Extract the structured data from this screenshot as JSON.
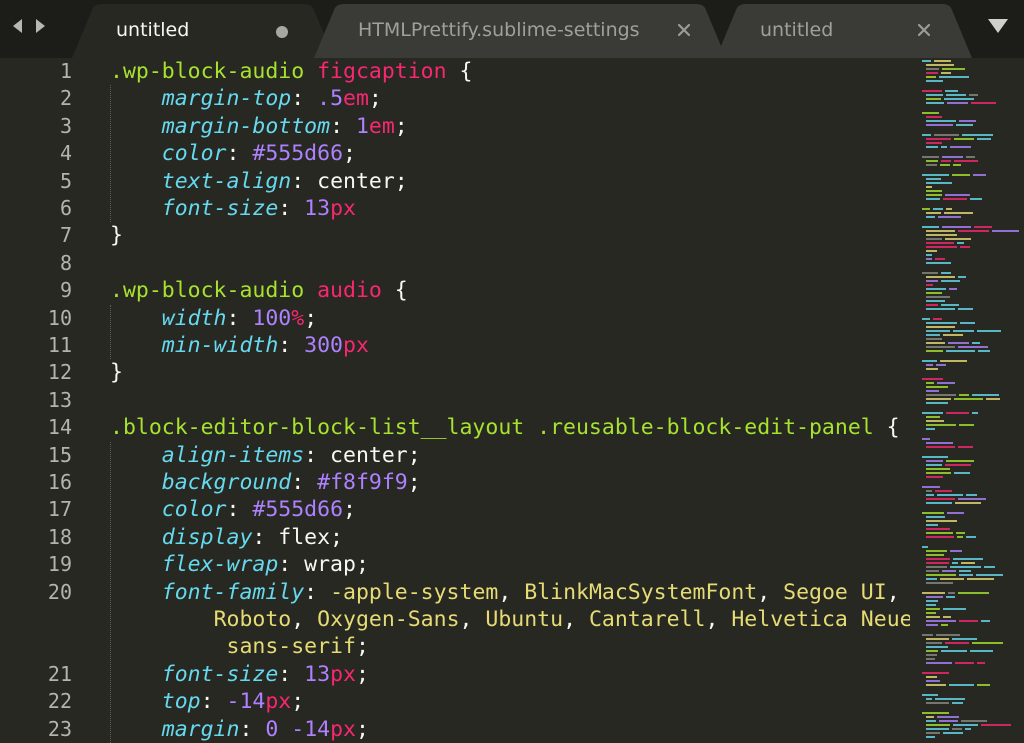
{
  "tabs": [
    {
      "title": "untitled",
      "active": true,
      "modified": true
    },
    {
      "title": "HTMLPrettify.sublime-settings",
      "active": false,
      "modified": false
    },
    {
      "title": "untitled",
      "active": false,
      "modified": false
    }
  ],
  "icons": {
    "back": "chevron-left-icon",
    "forward": "chevron-right-icon",
    "tab_menu": "triangle-down-icon",
    "close": "close-icon",
    "dirty": "modified-dot-icon"
  },
  "colors": {
    "background": "#272822",
    "tabbar": "#1c1d19",
    "selector": "#a6e22e",
    "tag": "#f92672",
    "property": "#66d9ef",
    "number": "#ae81ff",
    "string": "#e6db74",
    "text": "#f8f8f2",
    "line_number": "#b4b4ad"
  },
  "line_numbers": [
    "1",
    "2",
    "3",
    "4",
    "5",
    "6",
    "7",
    "8",
    "9",
    "10",
    "11",
    "12",
    "13",
    "14",
    "15",
    "16",
    "17",
    "18",
    "19",
    "20",
    "",
    "",
    "21",
    "22",
    "23"
  ],
  "code_lines": [
    [
      [
        "sel",
        ".wp-block-audio "
      ],
      [
        "tag",
        "figcaption"
      ],
      [
        "pun",
        " {"
      ]
    ],
    [
      [
        "pun",
        "    "
      ],
      [
        "prop",
        "margin-top"
      ],
      [
        "pun",
        ": "
      ],
      [
        "num",
        ".5"
      ],
      [
        "unit",
        "em"
      ],
      [
        "pun",
        ";"
      ]
    ],
    [
      [
        "pun",
        "    "
      ],
      [
        "prop",
        "margin-bottom"
      ],
      [
        "pun",
        ": "
      ],
      [
        "num",
        "1"
      ],
      [
        "unit",
        "em"
      ],
      [
        "pun",
        ";"
      ]
    ],
    [
      [
        "pun",
        "    "
      ],
      [
        "prop",
        "color"
      ],
      [
        "pun",
        ": "
      ],
      [
        "num",
        "#555d66"
      ],
      [
        "pun",
        ";"
      ]
    ],
    [
      [
        "pun",
        "    "
      ],
      [
        "prop",
        "text-align"
      ],
      [
        "pun",
        ": center;"
      ]
    ],
    [
      [
        "pun",
        "    "
      ],
      [
        "prop",
        "font-size"
      ],
      [
        "pun",
        ": "
      ],
      [
        "num",
        "13"
      ],
      [
        "unit",
        "px"
      ]
    ],
    [
      [
        "pun",
        "}"
      ]
    ],
    [],
    [
      [
        "sel",
        ".wp-block-audio "
      ],
      [
        "tag",
        "audio"
      ],
      [
        "pun",
        " {"
      ]
    ],
    [
      [
        "pun",
        "    "
      ],
      [
        "prop",
        "width"
      ],
      [
        "pun",
        ": "
      ],
      [
        "num",
        "100"
      ],
      [
        "unit",
        "%"
      ],
      [
        "pun",
        ";"
      ]
    ],
    [
      [
        "pun",
        "    "
      ],
      [
        "prop",
        "min-width"
      ],
      [
        "pun",
        ": "
      ],
      [
        "num",
        "300"
      ],
      [
        "unit",
        "px"
      ]
    ],
    [
      [
        "pun",
        "}"
      ]
    ],
    [],
    [
      [
        "sel",
        ".block-editor-block-list__layout .reusable-block-edit-panel"
      ],
      [
        "pun",
        " {"
      ]
    ],
    [
      [
        "pun",
        "    "
      ],
      [
        "prop",
        "align-items"
      ],
      [
        "pun",
        ": center;"
      ]
    ],
    [
      [
        "pun",
        "    "
      ],
      [
        "prop",
        "background"
      ],
      [
        "pun",
        ": "
      ],
      [
        "num",
        "#f8f9f9"
      ],
      [
        "pun",
        ";"
      ]
    ],
    [
      [
        "pun",
        "    "
      ],
      [
        "prop",
        "color"
      ],
      [
        "pun",
        ": "
      ],
      [
        "num",
        "#555d66"
      ],
      [
        "pun",
        ";"
      ]
    ],
    [
      [
        "pun",
        "    "
      ],
      [
        "prop",
        "display"
      ],
      [
        "pun",
        ": flex;"
      ]
    ],
    [
      [
        "pun",
        "    "
      ],
      [
        "prop",
        "flex-wrap"
      ],
      [
        "pun",
        ": wrap;"
      ]
    ],
    [
      [
        "pun",
        "    "
      ],
      [
        "prop",
        "font-family"
      ],
      [
        "pun",
        ": "
      ],
      [
        "str",
        "-apple-system"
      ],
      [
        "pun",
        ", "
      ],
      [
        "str",
        "BlinkMacSystemFont"
      ],
      [
        "pun",
        ", "
      ],
      [
        "str",
        "Segoe UI"
      ],
      [
        "pun",
        ","
      ]
    ],
    [
      [
        "pun",
        "        "
      ],
      [
        "str",
        "Roboto"
      ],
      [
        "pun",
        ", "
      ],
      [
        "str",
        "Oxygen-Sans"
      ],
      [
        "pun",
        ", "
      ],
      [
        "str",
        "Ubuntu"
      ],
      [
        "pun",
        ", "
      ],
      [
        "str",
        "Cantarell"
      ],
      [
        "pun",
        ", "
      ],
      [
        "str",
        "Helvetica Neue"
      ],
      [
        "pun",
        ","
      ]
    ],
    [
      [
        "pun",
        "         "
      ],
      [
        "str",
        "sans-serif"
      ],
      [
        "pun",
        ";"
      ]
    ],
    [
      [
        "pun",
        "    "
      ],
      [
        "prop",
        "font-size"
      ],
      [
        "pun",
        ": "
      ],
      [
        "num",
        "13"
      ],
      [
        "unit",
        "px"
      ],
      [
        "pun",
        ";"
      ]
    ],
    [
      [
        "pun",
        "    "
      ],
      [
        "prop",
        "top"
      ],
      [
        "pun",
        ": "
      ],
      [
        "num",
        "-14"
      ],
      [
        "unit",
        "px"
      ],
      [
        "pun",
        ";"
      ]
    ],
    [
      [
        "pun",
        "    "
      ],
      [
        "prop",
        "margin"
      ],
      [
        "pun",
        ": "
      ],
      [
        "num",
        "0"
      ],
      [
        "pun",
        " "
      ],
      [
        "num",
        "-14"
      ],
      [
        "unit",
        "px"
      ],
      [
        "pun",
        ";"
      ]
    ]
  ]
}
